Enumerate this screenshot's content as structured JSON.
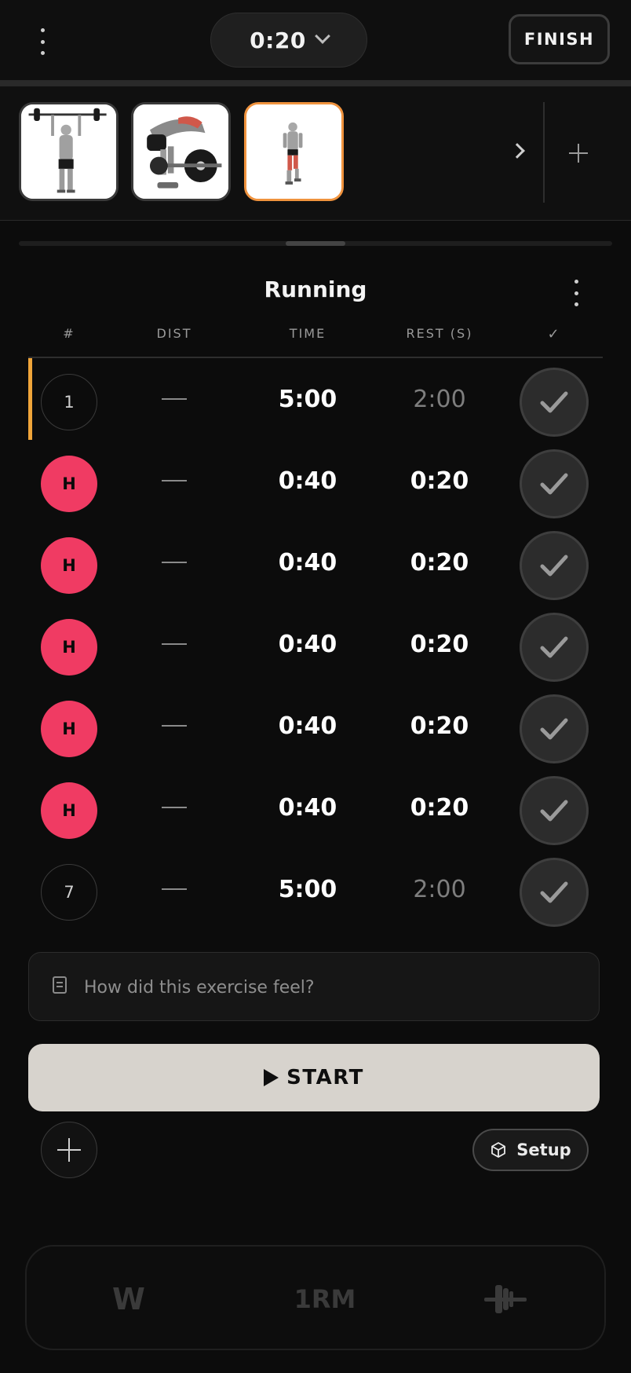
{
  "header": {
    "timer": "0:20",
    "finish_label": "FINISH"
  },
  "exercise": {
    "title": "Running"
  },
  "columns": {
    "num": "#",
    "dist": "DIST",
    "time": "TIME",
    "rest": "REST (S)",
    "done": "✓"
  },
  "sets": [
    {
      "label": "1",
      "type": "normal",
      "dist": "—",
      "time": "5:00",
      "rest": "2:00"
    },
    {
      "label": "H",
      "type": "hiit",
      "dist": "—",
      "time": "0:40",
      "rest": "0:20"
    },
    {
      "label": "H",
      "type": "hiit",
      "dist": "—",
      "time": "0:40",
      "rest": "0:20"
    },
    {
      "label": "H",
      "type": "hiit",
      "dist": "—",
      "time": "0:40",
      "rest": "0:20"
    },
    {
      "label": "H",
      "type": "hiit",
      "dist": "—",
      "time": "0:40",
      "rest": "0:20"
    },
    {
      "label": "H",
      "type": "hiit",
      "dist": "—",
      "time": "0:40",
      "rest": "0:20"
    },
    {
      "label": "7",
      "type": "normal",
      "dist": "—",
      "time": "5:00",
      "rest": "2:00"
    }
  ],
  "notes": {
    "placeholder": "How did this exercise feel?"
  },
  "start_label": "START",
  "setup_label": "Setup",
  "tools": {
    "w": "W",
    "one_rm": "1RM"
  },
  "colors": {
    "accent_orange": "#f0933e",
    "active_bar": "#f0a53a",
    "hiit_pink": "#f03b63",
    "start_bg": "#d7d3cd"
  }
}
